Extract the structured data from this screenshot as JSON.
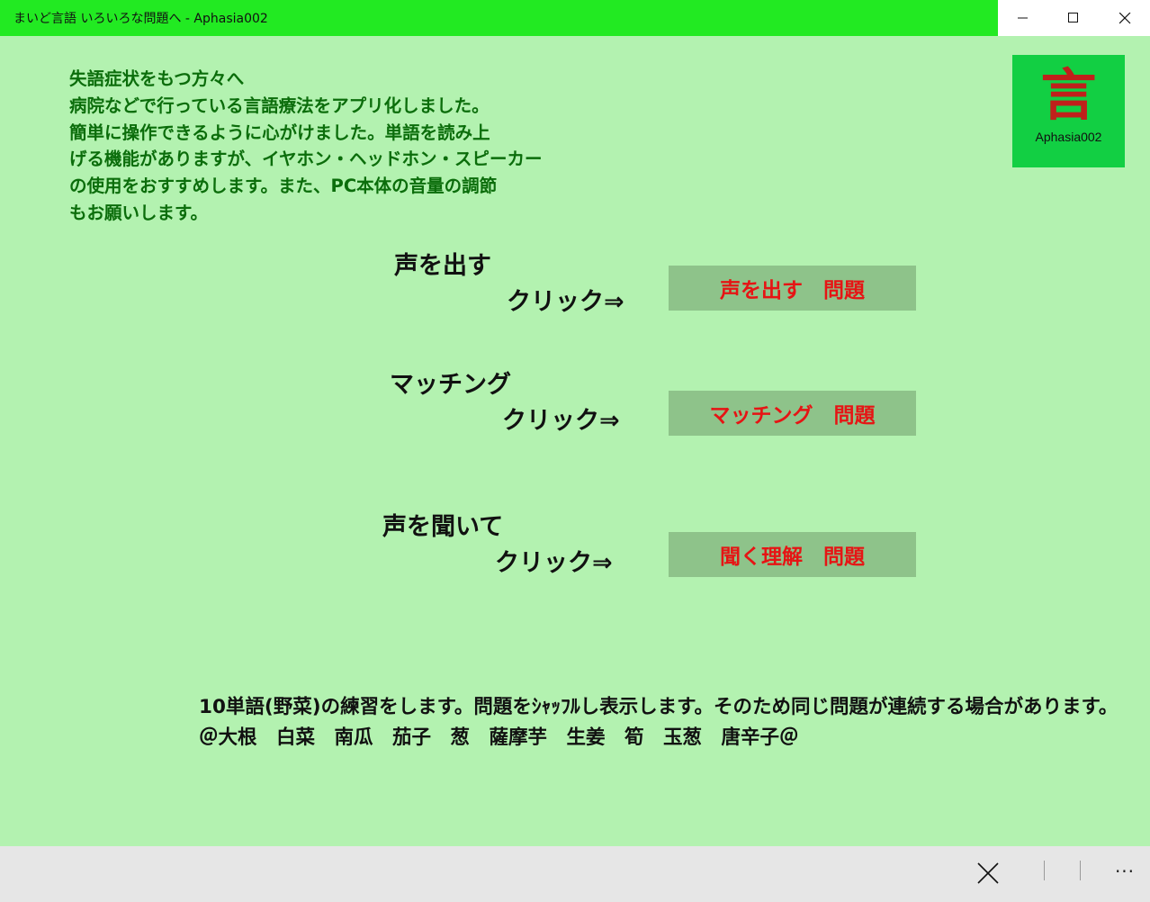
{
  "window": {
    "title": "まいど言語 いろいろな問題へ - Aphasia002",
    "colors": {
      "titlebar": "#22ea22",
      "background": "#b3f2b0"
    },
    "controls": [
      "minimize-icon",
      "maximize-icon",
      "close-icon"
    ]
  },
  "intro": {
    "lines": [
      "失語症状をもつ方々へ",
      "病院などで行っている言語療法をアプリ化しました。",
      "簡単に操作できるように心がけました。単語を読み上",
      "げる機能がありますが、イヤホン・ヘッドホン・スピーカー",
      "の使用をおすすめします。また、PC本体の音量の調節",
      "もお願いします。"
    ],
    "color": "#0b6d0b"
  },
  "logo": {
    "char": "言",
    "label": "Aphasia002",
    "bg": "#12cf43"
  },
  "sections": [
    {
      "title": "声を出す",
      "click": "クリック⇒",
      "button": "声を出す　問題"
    },
    {
      "title": "マッチング",
      "click": "クリック⇒",
      "button": "マッチング　問題"
    },
    {
      "title": "声を聞いて",
      "click": "クリック⇒",
      "button": "聞く理解　問題"
    }
  ],
  "button_colors": {
    "bg": "#8ec38a",
    "text": "#e61414"
  },
  "bottom": {
    "line1": "10単語(野菜)の練習をします。問題をｼｬｯﾌﾙし表示します。そのため同じ問題が連続する場合があります。",
    "line2": "＠大根　白菜　南瓜　茄子　葱　薩摩芋　生姜　筍　玉葱　唐辛子＠"
  },
  "appbar": {
    "more": "···",
    "icons": [
      "close-icon"
    ]
  }
}
